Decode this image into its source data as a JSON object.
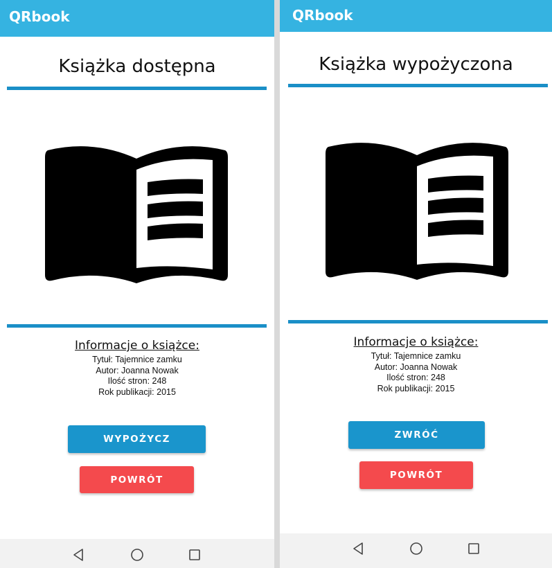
{
  "screens": [
    {
      "app_title": "QRbook",
      "status": "Książka dostępna",
      "info": {
        "heading": "Informacje o książce:",
        "title_line": "Tytuł: Tajemnice zamku",
        "author_line": "Autor: Joanna Nowak",
        "pages_line": "Ilość stron: 248",
        "year_line": "Rok publikacji: 2015"
      },
      "primary_button": "WYPOŻYCZ",
      "back_button": "POWRÓT"
    },
    {
      "app_title": "QRbook",
      "status": "Książka wypożyczona",
      "info": {
        "heading": "Informacje o książce:",
        "title_line": "Tytuł: Tajemnice zamku",
        "author_line": "Autor: Joanna Nowak",
        "pages_line": "Ilość stron: 248",
        "year_line": "Rok publikacji: 2015"
      },
      "primary_button": "ZWRÓĆ",
      "back_button": "POWRÓT"
    }
  ],
  "colors": {
    "app_bar": "#35b3e1",
    "divider": "#1a8fc7",
    "primary_button": "#1a95cc",
    "back_button": "#f44a4d",
    "nav_bar": "#f2f2f2"
  },
  "icons": {
    "book": "open-book-icon",
    "nav_back": "triangle-back-icon",
    "nav_home": "circle-home-icon",
    "nav_recents": "square-recents-icon"
  }
}
